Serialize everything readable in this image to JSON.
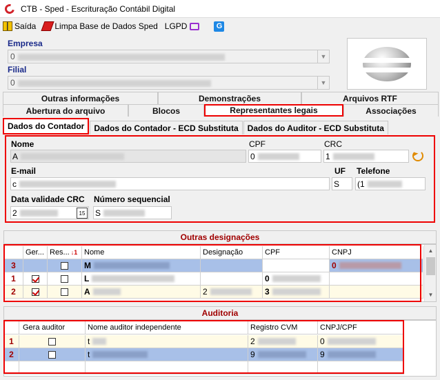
{
  "window": {
    "title": "CTB - Sped - Escrituração Contábil Digital"
  },
  "menu": [
    {
      "label": "Saída",
      "icon": "exit-icon"
    },
    {
      "label": "Limpa Base de Dados Sped",
      "icon": "eraser-icon"
    },
    {
      "label": "LGPD",
      "icon": "monitor-icon"
    },
    {
      "label": "",
      "icon": "g-icon"
    }
  ],
  "empresa": {
    "label": "Empresa",
    "value": "0"
  },
  "filial": {
    "label": "Filial",
    "value": "0"
  },
  "tabs_row1": [
    "Outras informações",
    "Demonstrações",
    "Arquivos RTF"
  ],
  "tabs_row2": [
    "Abertura do arquivo",
    "Blocos",
    "Representantes legais",
    "Associações"
  ],
  "subtabs": [
    "Dados do Contador",
    "Dados do Contador - ECD Substituta",
    "Dados do Auditor - ECD Substituta"
  ],
  "contador": {
    "nome_label": "Nome",
    "nome_value": "A",
    "cpf_label": "CPF",
    "cpf_value": "0",
    "crc_label": "CRC",
    "crc_value": "1",
    "email_label": "E-mail",
    "email_value": "c",
    "uf_label": "UF",
    "uf_value": "S",
    "telefone_label": "Telefone",
    "telefone_value": "(1",
    "validade_label": "Data validade CRC",
    "validade_value": "2",
    "calendar_label": "15",
    "seq_label": "Número sequencial",
    "seq_value": "S"
  },
  "outras": {
    "title": "Outras designações",
    "sort_marker": "1",
    "columns": [
      "",
      "Ger...",
      "Res...",
      "Nome",
      "Designação",
      "CPF",
      "CNPJ"
    ],
    "rows": [
      {
        "num": "3",
        "ger": false,
        "res": false,
        "nome": "M",
        "desig": "",
        "cpf": "",
        "cnpj": "0"
      },
      {
        "num": "1",
        "ger": true,
        "res": false,
        "nome": "L",
        "desig": "",
        "cpf": "0",
        "cnpj": ""
      },
      {
        "num": "2",
        "ger": true,
        "res": false,
        "nome": "A",
        "desig": "2",
        "cpf": "3",
        "cnpj": ""
      }
    ]
  },
  "auditoria": {
    "title": "Auditoria",
    "columns": [
      "",
      "Gera auditor",
      "Nome auditor independente",
      "Registro CVM",
      "CNPJ/CPF"
    ],
    "rows": [
      {
        "num": "1",
        "gera": false,
        "nome": "t",
        "cvm": "2",
        "cnpj": "0"
      },
      {
        "num": "2",
        "gera": false,
        "nome": "t",
        "cvm": "9",
        "cnpj": "9"
      }
    ]
  },
  "colors": {
    "highlight": "#e00000",
    "header_text": "#a00000",
    "row_selected": "#a8c0e8",
    "row_yellow": "#fffbe6"
  }
}
